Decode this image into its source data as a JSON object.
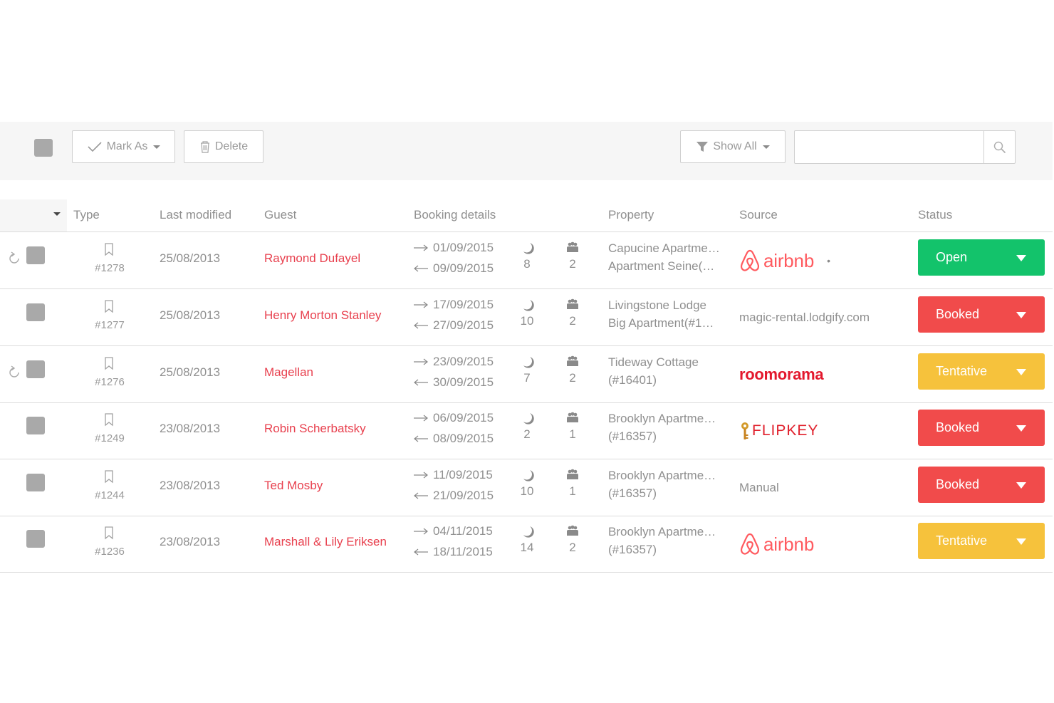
{
  "toolbar": {
    "mark_as_label": "Mark As",
    "delete_label": "Delete",
    "show_all_label": "Show All",
    "search_value": "",
    "search_placeholder": ""
  },
  "columns": {
    "type": "Type",
    "last_modified": "Last modified",
    "guest": "Guest",
    "booking_details": "Booking details",
    "property": "Property",
    "source": "Source",
    "status": "Status"
  },
  "colors": {
    "open": "#13c36b",
    "booked": "#f14b4b",
    "tentative": "#f6c23c",
    "guest_link": "#e8404e",
    "airbnb": "#ff5a5f"
  },
  "rows": [
    {
      "id": "#1278",
      "modified": "25/08/2013",
      "guest": "Raymond Dufayel",
      "arrive": "01/09/2015",
      "depart": "09/09/2015",
      "nights": "8",
      "guests": "2",
      "property_1": "Capucine Apartme…",
      "property_2": "Apartment Seine(…",
      "source_type": "airbnb",
      "source_text": "airbnb",
      "status": "Open",
      "status_kind": "open",
      "refresh": true
    },
    {
      "id": "#1277",
      "modified": "25/08/2013",
      "guest": "Henry Morton Stanley",
      "arrive": "17/09/2015",
      "depart": "27/09/2015",
      "nights": "10",
      "guests": "2",
      "property_1": "Livingstone Lodge",
      "property_2": "Big Apartment(#1…",
      "source_type": "text",
      "source_text": "magic-rental.lodgify.com",
      "status": "Booked",
      "status_kind": "booked",
      "refresh": false
    },
    {
      "id": "#1276",
      "modified": "25/08/2013",
      "guest": "Magellan",
      "arrive": "23/09/2015",
      "depart": "30/09/2015",
      "nights": "7",
      "guests": "2",
      "property_1": "Tideway Cottage",
      "property_2": "(#16401)",
      "source_type": "roomorama",
      "source_text": "roomorama",
      "status": "Tentative",
      "status_kind": "tentative",
      "refresh": true
    },
    {
      "id": "#1249",
      "modified": "23/08/2013",
      "guest": "Robin Scherbatsky",
      "arrive": "06/09/2015",
      "depart": "08/09/2015",
      "nights": "2",
      "guests": "1",
      "property_1": "Brooklyn Apartme…",
      "property_2": "(#16357)",
      "source_type": "flipkey",
      "source_text": "FLIPKEY",
      "status": "Booked",
      "status_kind": "booked",
      "refresh": false
    },
    {
      "id": "#1244",
      "modified": "23/08/2013",
      "guest": "Ted Mosby",
      "arrive": "11/09/2015",
      "depart": "21/09/2015",
      "nights": "10",
      "guests": "1",
      "property_1": "Brooklyn Apartme…",
      "property_2": "(#16357)",
      "source_type": "text",
      "source_text": "Manual",
      "status": "Booked",
      "status_kind": "booked",
      "refresh": false
    },
    {
      "id": "#1236",
      "modified": "23/08/2013",
      "guest": "Marshall & Lily Eriksen",
      "arrive": "04/11/2015",
      "depart": "18/11/2015",
      "nights": "14",
      "guests": "2",
      "property_1": "Brooklyn Apartme…",
      "property_2": "(#16357)",
      "source_type": "airbnb",
      "source_text": "airbnb",
      "status": "Tentative",
      "status_kind": "tentative",
      "refresh": false
    }
  ]
}
